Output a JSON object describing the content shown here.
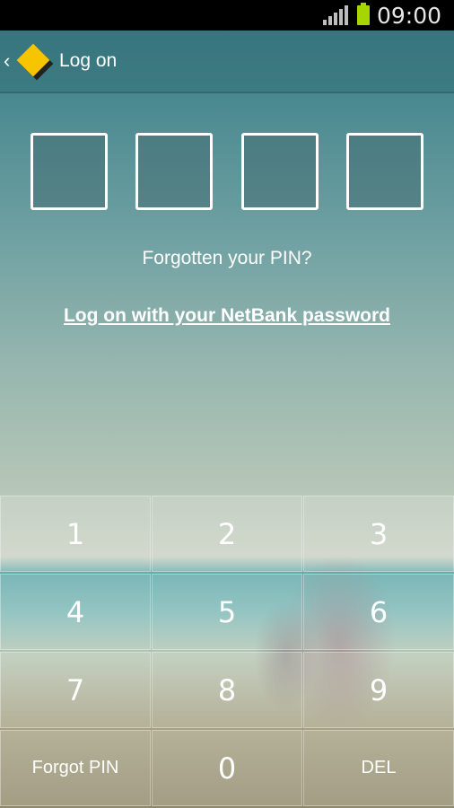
{
  "status_bar": {
    "time": "09:00"
  },
  "header": {
    "title": "Log on"
  },
  "pin": {
    "forgot_prompt": "Forgotten your PIN?",
    "netbank_link": "Log on with your NetBank password"
  },
  "keypad": {
    "keys": [
      "1",
      "2",
      "3",
      "4",
      "5",
      "6",
      "7",
      "8",
      "9"
    ],
    "forgot_label": "Forgot PIN",
    "zero_label": "0",
    "delete_label": "DEL"
  },
  "colors": {
    "logo": "#f7c400",
    "battery": "#a6d600"
  }
}
